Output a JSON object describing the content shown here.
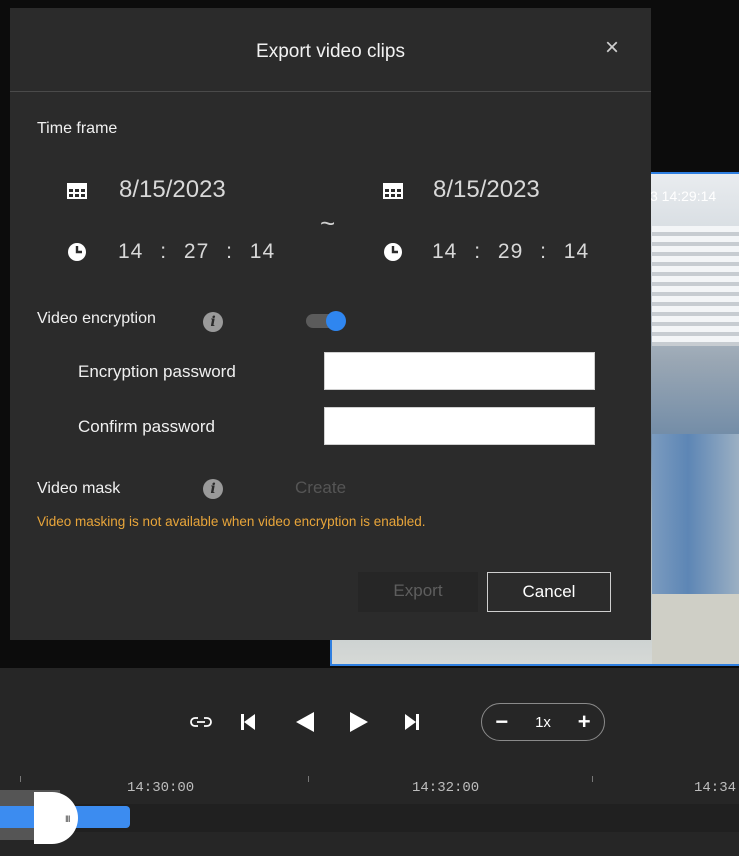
{
  "dialog": {
    "title": "Export video clips",
    "time_frame_label": "Time frame",
    "start": {
      "date": "8/15/2023",
      "hour": "14",
      "minute": "27",
      "second": "14"
    },
    "end": {
      "date": "8/15/2023",
      "hour": "14",
      "minute": "29",
      "second": "14"
    },
    "range_separator": "~",
    "time_separator": ":",
    "video_encryption_label": "Video encryption",
    "video_encryption_enabled": true,
    "encryption_password_label": "Encryption password",
    "encryption_password_value": "",
    "confirm_password_label": "Confirm password",
    "confirm_password_value": "",
    "video_mask_label": "Video mask",
    "create_label": "Create",
    "warning_text": "Video masking is not available when video encryption is enabled.",
    "export_label": "Export",
    "cancel_label": "Cancel",
    "info_glyph": "i",
    "close_glyph": "×"
  },
  "player": {
    "video_timestamp": "3 14:29:14",
    "speed_label": "1x",
    "minus_glyph": "−",
    "plus_glyph": "+",
    "timeline_ticks": [
      "14:30:00",
      "14:32:00",
      "14:34"
    ],
    "handle_glyph": "III"
  },
  "colors": {
    "accent": "#2f86f0",
    "warning": "#e8a53a",
    "dialog_bg": "#2b2b2b"
  }
}
